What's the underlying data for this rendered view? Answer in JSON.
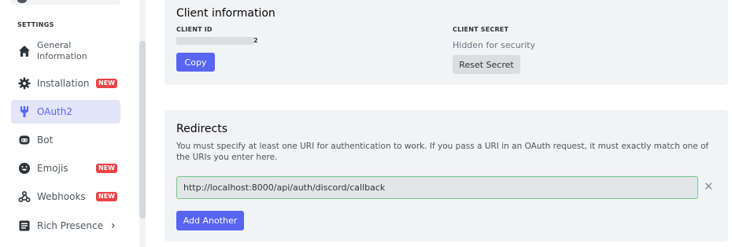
{
  "sidebar": {
    "section_title": "SETTINGS",
    "items": [
      {
        "label": "General Information",
        "icon": "home-icon",
        "badge": ""
      },
      {
        "label": "Installation",
        "icon": "gear-icon",
        "badge": "NEW"
      },
      {
        "label": "OAuth2",
        "icon": "wrench-icon",
        "badge": "",
        "active": true
      },
      {
        "label": "Bot",
        "icon": "robot-icon",
        "badge": ""
      },
      {
        "label": "Emojis",
        "icon": "smiley-icon",
        "badge": "NEW"
      },
      {
        "label": "Webhooks",
        "icon": "webhook-icon",
        "badge": "NEW"
      },
      {
        "label": "Rich Presence",
        "icon": "list-icon",
        "badge": "",
        "has_chevron": true
      }
    ]
  },
  "client_info": {
    "title": "Client information",
    "client_id_label": "CLIENT ID",
    "client_id_tail": "2",
    "copy_label": "Copy",
    "client_secret_label": "CLIENT SECRET",
    "secret_hidden_text": "Hidden for security",
    "reset_secret_label": "Reset Secret"
  },
  "redirects": {
    "title": "Redirects",
    "description": "You must specify at least one URI for authentication to work. If you pass a URI in an OAuth request, it must exactly match one of the URIs you enter here.",
    "uris": [
      "http://localhost:8000/api/auth/discord/callback"
    ],
    "add_another_label": "Add Another"
  },
  "colors": {
    "accent": "#5865f2",
    "badge": "#ed4245",
    "panel_bg": "#f2f3f5",
    "valid_border": "#72c98a"
  }
}
